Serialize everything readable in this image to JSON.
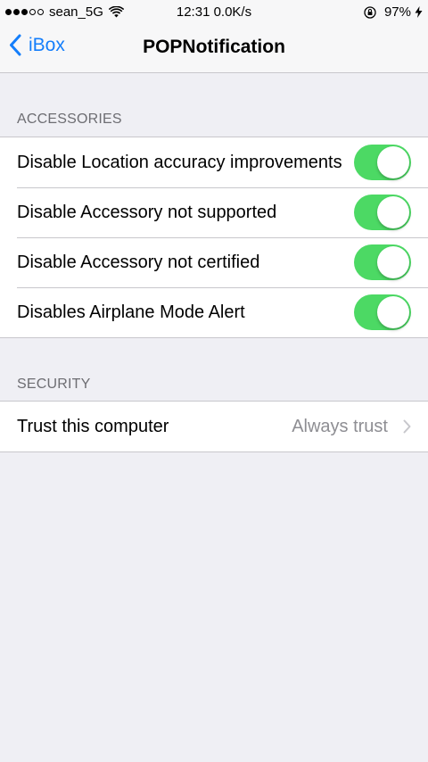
{
  "status_bar": {
    "signal_filled": 3,
    "signal_total": 5,
    "carrier": "sean_5G",
    "center": "12:31 0.0K/s",
    "battery": "97%",
    "icons": [
      "signal-dots",
      "wifi-icon",
      "rotation-lock-icon",
      "charging-bolt-icon"
    ]
  },
  "nav": {
    "back_label": "iBox",
    "title": "POPNotification",
    "accent": "#147efb"
  },
  "sections": {
    "accessories": {
      "header": "ACCESSORIES",
      "items": [
        {
          "label": "Disable Location accuracy improvements",
          "on": true
        },
        {
          "label": "Disable Accessory not supported",
          "on": true
        },
        {
          "label": "Disable Accessory not certified",
          "on": true
        },
        {
          "label": "Disables Airplane Mode Alert",
          "on": true
        }
      ]
    },
    "security": {
      "header": "SECURITY",
      "items": [
        {
          "label": "Trust this computer",
          "value": "Always trust"
        }
      ]
    }
  },
  "colors": {
    "switch_on": "#4cd964",
    "background": "#efeff4",
    "secondary_text": "#8e8e93"
  }
}
